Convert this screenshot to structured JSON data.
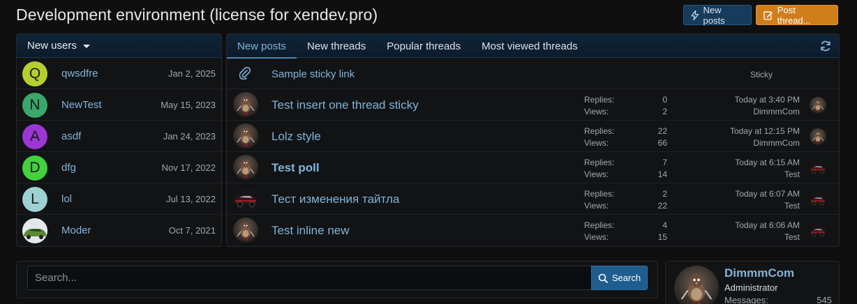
{
  "page": {
    "title": "Development environment (license for xendev.pro)"
  },
  "buttons": {
    "new_posts": "New posts",
    "post_thread": "Post thread..."
  },
  "users_widget": {
    "header": "New users",
    "items": [
      {
        "initial": "Q",
        "name": "qwsdfre",
        "date": "Jan 2, 2025",
        "color": "#b6cf2f"
      },
      {
        "initial": "N",
        "name": "NewTest",
        "date": "May 15, 2023",
        "color": "#3aa86b"
      },
      {
        "initial": "A",
        "name": "asdf",
        "date": "Jan 24, 2023",
        "color": "#9c37d6"
      },
      {
        "initial": "D",
        "name": "dfg",
        "date": "Nov 17, 2022",
        "color": "#43d13d"
      },
      {
        "initial": "L",
        "name": "lol",
        "date": "Jul 13, 2022",
        "color": "#9fd1d2"
      },
      {
        "initial": "",
        "name": "Moder",
        "date": "Oct 7, 2021",
        "color": "#d8e0e4"
      }
    ]
  },
  "threads_widget": {
    "tabs": [
      {
        "label": "New posts",
        "active": true
      },
      {
        "label": "New threads",
        "active": false
      },
      {
        "label": "Popular threads",
        "active": false
      },
      {
        "label": "Most viewed threads",
        "active": false
      }
    ],
    "sticky_link": {
      "title": "Sample sticky link",
      "label": "Sticky"
    },
    "replies_label": "Replies:",
    "views_label": "Views:",
    "rows": [
      {
        "title": "Test insert one thread sticky",
        "replies": "0",
        "views": "2",
        "time": "Today at 3:40 PM",
        "user": "DimmmCom",
        "bold": false,
        "avatar": "bird",
        "last_avatar": "bird"
      },
      {
        "title": "Lolz style",
        "replies": "22",
        "views": "66",
        "time": "Today at 12:15 PM",
        "user": "DimmmCom",
        "bold": false,
        "avatar": "bird",
        "last_avatar": "bird"
      },
      {
        "title": "Test poll",
        "replies": "7",
        "views": "14",
        "time": "Today at 6:15 AM",
        "user": "Test",
        "bold": true,
        "avatar": "bird",
        "last_avatar": "car"
      },
      {
        "title": "Тест изменения тайтла",
        "replies": "2",
        "views": "22",
        "time": "Today at 6:07 AM",
        "user": "Test",
        "bold": false,
        "avatar": "car",
        "last_avatar": "car"
      },
      {
        "title": "Test inline new",
        "replies": "4",
        "views": "15",
        "time": "Today at 6:06 AM",
        "user": "Test",
        "bold": false,
        "avatar": "bird",
        "last_avatar": "car"
      }
    ]
  },
  "search": {
    "placeholder": "Search...",
    "button": "Search"
  },
  "member_card": {
    "name": "DimmmCom",
    "role": "Administrator",
    "messages_label": "Messages:",
    "messages_value": "545"
  }
}
